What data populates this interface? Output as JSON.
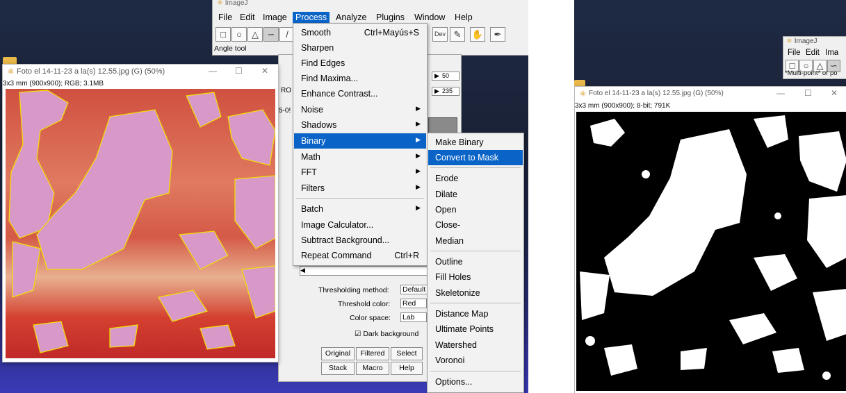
{
  "left": {
    "main_window_title": "ImageJ",
    "menubar": [
      "File",
      "Edit",
      "Image",
      "Process",
      "Analyze",
      "Plugins",
      "Window",
      "Help"
    ],
    "status": "Angle tool",
    "image_window": {
      "title": "Foto el 14-11-23 a la(s) 12.55.jpg (G) (50%)",
      "info": "3x3 mm (900x900); RGB; 3.1MB"
    },
    "process_menu": [
      {
        "label": "Smooth",
        "shortcut": "Ctrl+Mayús+S"
      },
      {
        "label": "Sharpen"
      },
      {
        "label": "Find Edges"
      },
      {
        "label": "Find Maxima..."
      },
      {
        "label": "Enhance Contrast..."
      },
      {
        "label": "Noise",
        "submenu": true
      },
      {
        "label": "Shadows",
        "submenu": true
      },
      {
        "label": "Binary",
        "submenu": true,
        "highlight": true
      },
      {
        "label": "Math",
        "submenu": true
      },
      {
        "label": "FFT",
        "submenu": true
      },
      {
        "label": "Filters",
        "submenu": true
      },
      {
        "label": "Batch",
        "submenu": true
      },
      {
        "label": "Image Calculator..."
      },
      {
        "label": "Subtract Background..."
      },
      {
        "label": "Repeat Command",
        "shortcut": "Ctrl+R"
      }
    ],
    "binary_menu": [
      "Make Binary",
      "Convert to Mask",
      "Erode",
      "Dilate",
      "Open",
      "Close-",
      "Median",
      "Outline",
      "Fill Holes",
      "Skeletonize",
      "Distance Map",
      "Ultimate Points",
      "Watershed",
      "Voronoi",
      "Options..."
    ],
    "threshold": {
      "slider1_value": "50",
      "slider2_value": "235",
      "method_label": "Thresholding method:",
      "method_value": "Default",
      "color_label": "Threshold color:",
      "color_value": "Red",
      "space_label": "Color space:",
      "space_value": "Lab",
      "dark_bg_label": "Dark background",
      "buttons_row1": [
        "Original",
        "Filtered",
        "Select"
      ],
      "buttons_row2": [
        "Stack",
        "Macro",
        "Help"
      ],
      "ro_label": "RO",
      "side_label": "5-0!"
    }
  },
  "right": {
    "main_window_title": "ImageJ",
    "menubar": [
      "File",
      "Edit",
      "Ima"
    ],
    "status": "*Multi-point* or po",
    "image_window": {
      "title": "Foto el 14-11-23 a la(s) 12.55.jpg (G) (50%)",
      "info": "3x3 mm (900x900); 8-bit; 791K"
    }
  },
  "icons": [
    "rectangle-tool-icon",
    "oval-tool-icon",
    "polygon-tool-icon",
    "freehand-tool-icon",
    "dev-tool-icon",
    "pencil-tool-icon",
    "hand-tool-icon",
    "dropper-tool-icon",
    "imagej-logo-icon"
  ],
  "colors": {
    "menu_highlight": "#0a64c8",
    "selection_outline": "#f2e200",
    "image_pink": "#d98fc7",
    "image_red": "#cc3a2a"
  }
}
